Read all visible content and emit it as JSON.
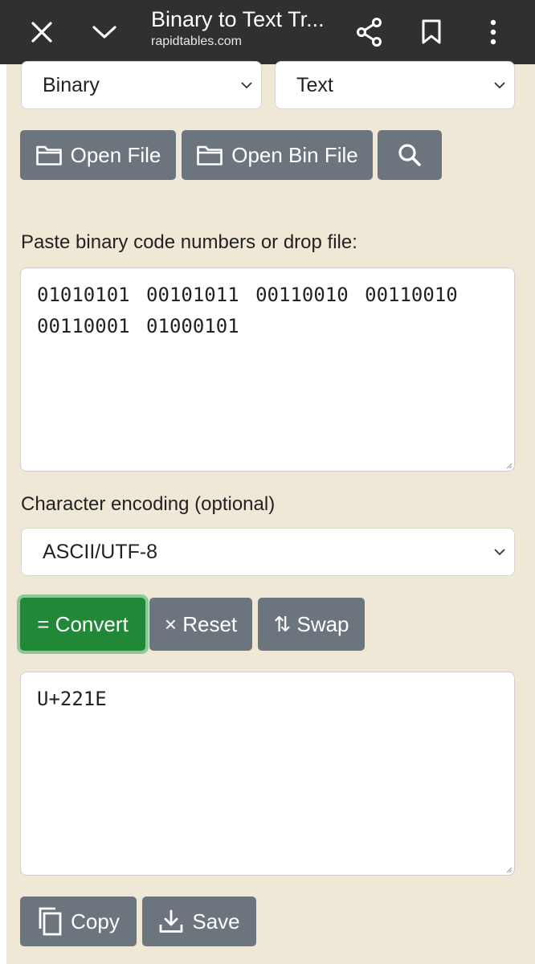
{
  "browser": {
    "title": "Binary to Text Tr...",
    "url": "rapidtables.com"
  },
  "converter": {
    "from_select": "Binary",
    "to_select": "Text",
    "open_file_label": "Open File",
    "open_bin_file_label": "Open Bin File",
    "paste_label": "Paste binary code numbers or drop file:",
    "input_value": "01010101 00101011 00110010 00110010 00110001 01000101",
    "encoding_label": "Character encoding (optional)",
    "encoding_select": "ASCII/UTF-8",
    "convert_label": "= Convert",
    "reset_label": "× Reset",
    "swap_label": "⇅ Swap",
    "output_value": "U+221E",
    "copy_label": "Copy",
    "save_label": "Save"
  },
  "colors": {
    "topbar": "#2f3030",
    "page_bg": "#efe8d6",
    "button_gray": "#6c757d",
    "convert_green": "#218838"
  },
  "icons": [
    "close-icon",
    "chevron-down-icon",
    "share-icon",
    "bookmark-icon",
    "more-vert-icon",
    "folder-icon",
    "search-icon",
    "copy-icon",
    "download-icon"
  ]
}
